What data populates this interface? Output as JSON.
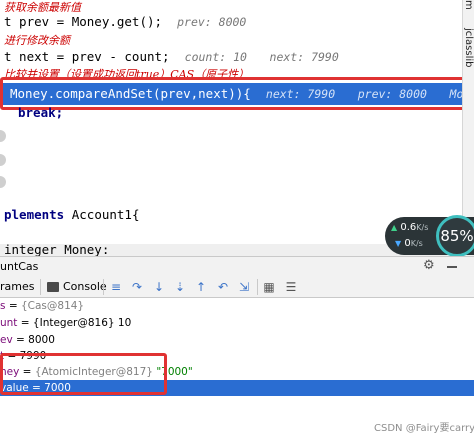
{
  "editor": {
    "line1": {
      "comment": "获取余额最新值",
      "code": "t prev = Money.get();",
      "hint": "prev: 8000"
    },
    "line2": {
      "comment": "进行修改余额",
      "code": "t next = prev - count;",
      "hint1": "count: 10",
      "hint2": "next: 7990"
    },
    "line3": {
      "comment": "比较并设置（设置成功返回true）CAS（原子性）"
    },
    "current_line": {
      "code": "Money.compareAndSet(prev,next)){",
      "hint1": "next: 7990",
      "hint2": "prev: 8000",
      "hint3": "Money: \""
    },
    "break_line": "break;",
    "class_line": {
      "kw": "plements",
      "rest": " Account1{"
    },
    "field_line": "integer Money:",
    "side_tab": "jclasslib",
    "side_tab_top": "m"
  },
  "network_widget": {
    "upload": "0.6",
    "upload_unit": "K/s",
    "download": "0",
    "download_unit": "K/s",
    "cpu_percent": "85",
    "cpu_label": "85%"
  },
  "debug": {
    "title": "untCas",
    "toolbar": {
      "frames_label": "rames",
      "console_label": "Console"
    },
    "variables": [
      {
        "name": "s",
        "value": "{Cas@814}"
      },
      {
        "name": "unt",
        "value": "{Integer@816} 10"
      },
      {
        "name": "ev",
        "value": "= 8000"
      },
      {
        "name": "t",
        "value": "= 7990"
      },
      {
        "name": "ney",
        "value": "{AtomicInteger@817}",
        "str": "\"7000\""
      },
      {
        "name": "value",
        "value": "= 7000"
      }
    ]
  },
  "watermark": "CSDN @Fairy要carry",
  "colors": {
    "selection": "#2a6dd2",
    "highlight_border": "#e03232",
    "comment": "#cc0000"
  }
}
